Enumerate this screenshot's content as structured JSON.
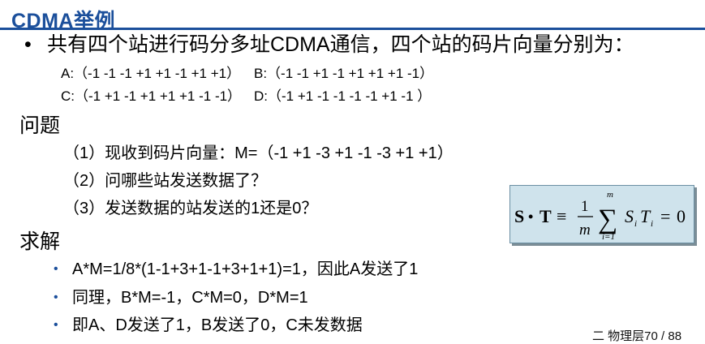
{
  "title": "CDMA举例",
  "intro": "共有四个站进行码分多址CDMA通信，四个站的码片向量分别为：",
  "codes": {
    "a": "A:（-1 -1 -1 +1 +1 -1 +1 +1）",
    "b": "B:（-1 -1 +1 -1 +1 +1 +1 -1）",
    "c": "C:（-1 +1 -1 +1 +1 +1 -1 -1）",
    "d": "D:（-1 +1 -1 -1 -1 -1 +1 -1 ）"
  },
  "question_heading": "问题",
  "questions": [
    "（1）现收到码片向量：M=（-1 +1 -3 +1 -1 -3 +1 +1）",
    "（2）问哪些站发送数据了？",
    "（3）发送数据的站发送的1还是0？"
  ],
  "solution_heading": "求解",
  "solutions": [
    "A*M=1/8*(1-1+3+1-1+3+1+1)=1，因此A发送了1",
    "同理，B*M=-1，C*M=0，D*M=1",
    "即A、D发送了1，B发送了0，C未发数据"
  ],
  "formula": {
    "lhs_s": "S",
    "dot": "•",
    "lhs_t": "T",
    "equiv": "≡",
    "frac_num": "1",
    "frac_den": "m",
    "sum_upper": "m",
    "sum_lower": "i=1",
    "term_s": "S",
    "sub_i1": "i",
    "term_t": "T",
    "sub_i2": "i",
    "equals": "=",
    "result": "0"
  },
  "footer": "二 物理层70 / 88"
}
